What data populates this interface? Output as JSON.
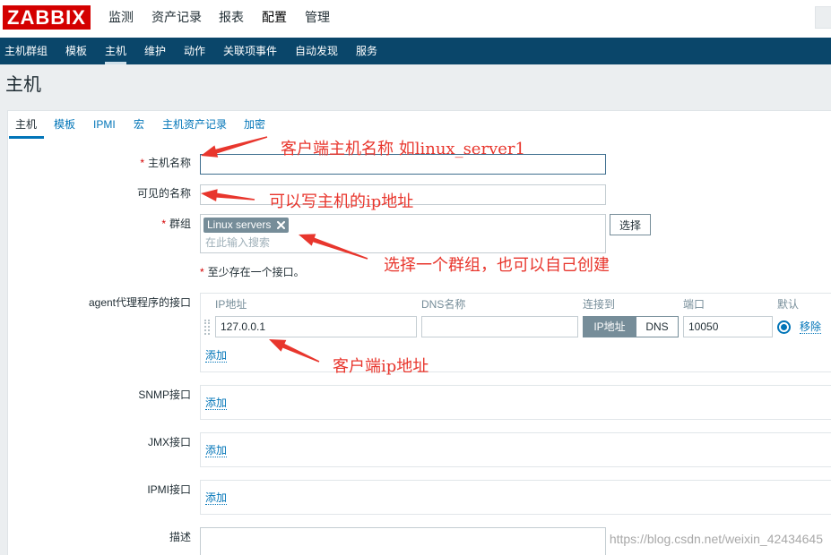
{
  "header": {
    "logo": "ZABBIX",
    "menu": [
      {
        "label": "监测",
        "active": false
      },
      {
        "label": "资产记录",
        "active": false
      },
      {
        "label": "报表",
        "active": false
      },
      {
        "label": "配置",
        "active": true
      },
      {
        "label": "管理",
        "active": false
      }
    ],
    "search": {
      "value": ""
    }
  },
  "subnav": {
    "items": [
      {
        "label": "主机群组",
        "selected": false
      },
      {
        "label": "模板",
        "selected": false
      },
      {
        "label": "主机",
        "selected": true
      },
      {
        "label": "维护",
        "selected": false
      },
      {
        "label": "动作",
        "selected": false
      },
      {
        "label": "关联项事件",
        "selected": false
      },
      {
        "label": "自动发现",
        "selected": false
      },
      {
        "label": "服务",
        "selected": false
      }
    ]
  },
  "page": {
    "title": "主机"
  },
  "tabs": [
    {
      "label": "主机",
      "active": true
    },
    {
      "label": "模板",
      "active": false
    },
    {
      "label": "IPMI",
      "active": false
    },
    {
      "label": "宏",
      "active": false
    },
    {
      "label": "主机资产记录",
      "active": false
    },
    {
      "label": "加密",
      "active": false
    }
  ],
  "form": {
    "required_mark": "*",
    "host_name": {
      "label": "主机名称",
      "required": true,
      "value": ""
    },
    "visible_name": {
      "label": "可见的名称",
      "required": false,
      "value": ""
    },
    "groups": {
      "label": "群组",
      "required": true,
      "selected": [
        "Linux servers"
      ],
      "placeholder": "在此输入搜索",
      "select_button": "选择"
    },
    "interface_note": "至少存在一个接口。",
    "agent_interfaces": {
      "label": "agent代理程序的接口",
      "columns": {
        "ip": "IP地址",
        "dns": "DNS名称",
        "connect_to": "连接到",
        "port": "端口",
        "default": "默认"
      },
      "rows": [
        {
          "ip": "127.0.0.1",
          "dns": "",
          "connect_to": [
            {
              "label": "IP地址",
              "active": true
            },
            {
              "label": "DNS",
              "active": false
            }
          ],
          "port": "10050",
          "default": true,
          "remove": "移除"
        }
      ],
      "add": "添加"
    },
    "snmp_interfaces": {
      "label": "SNMP接口",
      "add": "添加"
    },
    "jmx_interfaces": {
      "label": "JMX接口",
      "add": "添加"
    },
    "ipmi_interfaces": {
      "label": "IPMI接口",
      "add": "添加"
    },
    "description": {
      "label": "描述",
      "value": ""
    }
  },
  "annotations": [
    "客户端主机名称 如linux_server1",
    "可以写主机的ip地址",
    "选择一个群组，也可以自己创建",
    "客户端ip地址"
  ],
  "watermark": "https://blog.csdn.net/weixin_42434645",
  "icons": {
    "chip_remove": "close-icon",
    "drag_handle": "drag-handle-icon",
    "default_radio": "radio-checked-icon",
    "annotation_pointer": "arrow-icon"
  },
  "colors": {
    "brand": "#d40000",
    "accent": "#0275b8",
    "subnav_bg": "#0a466a",
    "page_bg": "#ebeef0",
    "chip_bg": "#768d99",
    "annotation": "#e8362d",
    "watermark": "#a8a8a8"
  }
}
